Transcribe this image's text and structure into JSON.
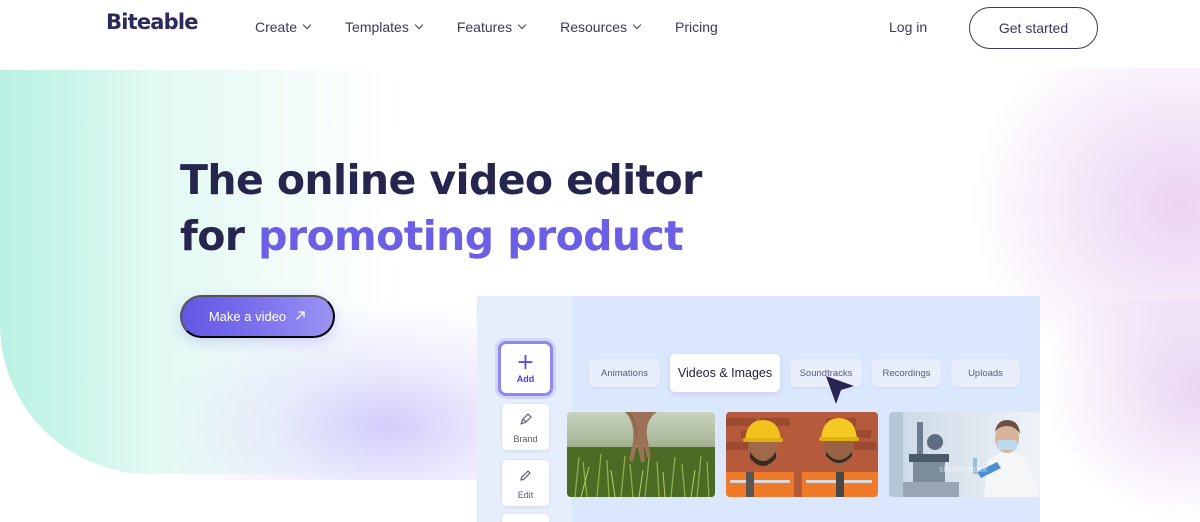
{
  "brand": {
    "logo": "Biteable"
  },
  "nav": {
    "items": [
      {
        "label": "Create",
        "has_dropdown": true
      },
      {
        "label": "Templates",
        "has_dropdown": true
      },
      {
        "label": "Features",
        "has_dropdown": true
      },
      {
        "label": "Resources",
        "has_dropdown": true
      },
      {
        "label": "Pricing",
        "has_dropdown": false
      }
    ],
    "login": "Log in",
    "cta": "Get started"
  },
  "hero": {
    "title_line1": "The online video editor",
    "title_line2_prefix": "for ",
    "title_line2_accent": "promoting product",
    "button": "Make a video",
    "button_icon": "arrow-up-right-icon"
  },
  "editor": {
    "tools": [
      {
        "label": "Add",
        "icon": "plus-icon"
      },
      {
        "label": "Brand",
        "icon": "brush-icon"
      },
      {
        "label": "Edit",
        "icon": "pencil-icon"
      }
    ],
    "tabs": [
      {
        "label": "Animations"
      },
      {
        "label": "Videos & Images",
        "active": true
      },
      {
        "label": "Soundtracks"
      },
      {
        "label": "Recordings"
      },
      {
        "label": "Uploads"
      }
    ],
    "thumbnails": [
      {
        "subject": "hand-touching-grass"
      },
      {
        "subject": "two-construction-workers"
      },
      {
        "subject": "lab-scientist"
      }
    ]
  },
  "colors": {
    "accent": "#6c5fe6",
    "text_dark": "#26254d",
    "cta_gradient_start": "#6257e4",
    "cta_gradient_end": "#9b93f3",
    "editor_bg": "#dbe7fc"
  }
}
